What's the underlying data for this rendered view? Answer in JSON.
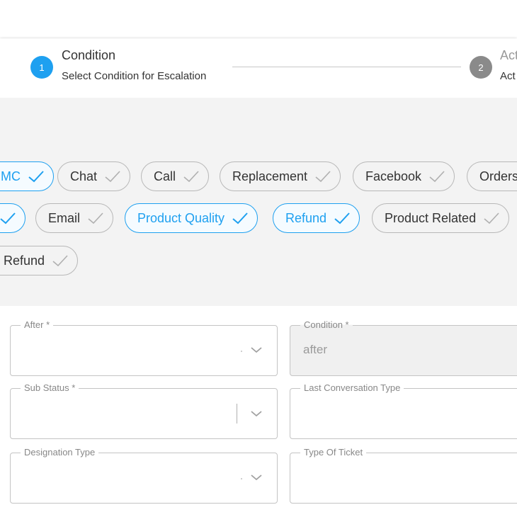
{
  "stepper": {
    "step1": {
      "number": "1",
      "title": "Condition",
      "subtitle": "Select Condition for Escalation"
    },
    "step2": {
      "number": "2",
      "title": "Act",
      "subtitle": "Act"
    }
  },
  "chips": {
    "row1": [
      {
        "label": "MC",
        "selected": true
      },
      {
        "label": "Chat",
        "selected": false
      },
      {
        "label": "Call",
        "selected": false
      },
      {
        "label": "Replacement",
        "selected": false
      },
      {
        "label": "Facebook",
        "selected": false
      },
      {
        "label": "Orders",
        "selected": false
      }
    ],
    "row2": [
      {
        "label": "",
        "selected": true
      },
      {
        "label": "Email",
        "selected": false
      },
      {
        "label": "Product Quality",
        "selected": true
      },
      {
        "label": "Refund",
        "selected": true
      },
      {
        "label": "Product Related",
        "selected": false
      }
    ],
    "row3": [
      {
        "label": "Refund",
        "selected": false
      }
    ]
  },
  "form": {
    "after": {
      "label": "After *",
      "value": ""
    },
    "condition": {
      "label": "Condition *",
      "value": "after"
    },
    "sub_status": {
      "label": "Sub Status *",
      "value": ""
    },
    "last_conversation_type": {
      "label": "Last Conversation Type",
      "value": ""
    },
    "designation_type": {
      "label": "Designation Type",
      "value": ""
    },
    "type_of_ticket": {
      "label": "Type Of Ticket",
      "value": ""
    }
  },
  "colors": {
    "accent": "#1ea0f0",
    "inactive_step": "#8a8a8a",
    "chips_background": "#f3f3f3",
    "chip_border": "#b8b8b8"
  },
  "icons": {
    "chip_check": "check-icon",
    "select_arrow": "chevron-down-icon"
  }
}
